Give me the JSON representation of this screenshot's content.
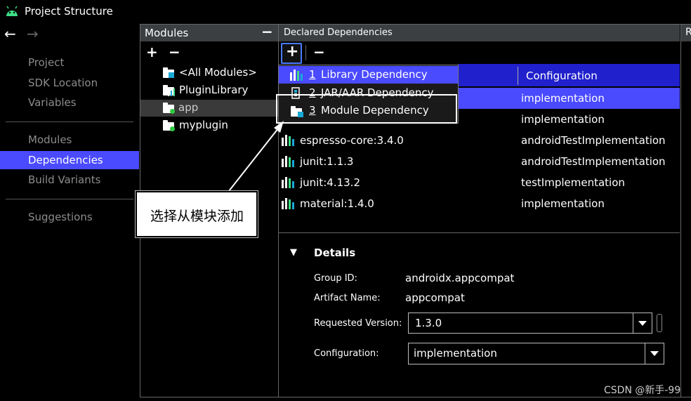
{
  "window": {
    "title": "Project Structure"
  },
  "nav": {
    "back_arrow": "←",
    "forward_arrow": "→",
    "items": [
      {
        "label": "Project"
      },
      {
        "label": "SDK Location"
      },
      {
        "label": "Variables"
      },
      {
        "label": "Modules"
      },
      {
        "label": "Dependencies"
      },
      {
        "label": "Build Variants"
      },
      {
        "label": "Suggestions"
      }
    ],
    "selected": "Dependencies"
  },
  "modules_panel": {
    "header": "Modules",
    "add": "+",
    "remove": "−",
    "collapse": "−",
    "items": [
      {
        "label": "<All Modules>"
      },
      {
        "label": "PluginLibrary"
      },
      {
        "label": "app"
      },
      {
        "label": "myplugin"
      }
    ],
    "selected": "app"
  },
  "deps_panel": {
    "header": "Declared Dependencies",
    "add": "+",
    "remove": "−",
    "configuration_header": "Configuration",
    "rows": [
      {
        "name": "",
        "config": "implementation"
      },
      {
        "name": "",
        "config": "implementation"
      },
      {
        "name": "espresso-core:3.4.0",
        "config": "androidTestImplementation"
      },
      {
        "name": "junit:1.1.3",
        "config": "androidTestImplementation"
      },
      {
        "name": "junit:4.13.2",
        "config": "testImplementation"
      },
      {
        "name": "material:1.4.0",
        "config": "implementation"
      }
    ]
  },
  "add_menu": {
    "items": [
      {
        "num": "1",
        "label": "Library Dependency"
      },
      {
        "num": "2",
        "label": "JAR/AAR Dependency"
      },
      {
        "num": "3",
        "label": "Module Dependency"
      }
    ]
  },
  "right_panel_header": "R",
  "details": {
    "toggle": "▼",
    "title": "Details",
    "group_label": "Group ID:",
    "group_value": "androidx.appcompat",
    "artifact_label": "Artifact Name:",
    "artifact_value": "appcompat",
    "version_label": "Requested Version:",
    "version_value": "1.3.0",
    "config_label": "Configuration:",
    "config_value": "implementation"
  },
  "annotation": {
    "text": "选择从模块添加"
  },
  "watermark": "CSDN @新手-99",
  "colors": {
    "accent": "#4a4aff",
    "background": "#000000",
    "header": "#3c3f41",
    "android_green": "#3ddc84"
  }
}
